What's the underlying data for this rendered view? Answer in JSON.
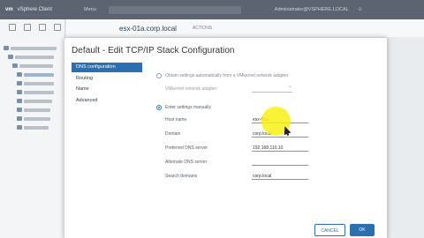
{
  "topbar": {
    "app_name": "vSphere Client",
    "menu_label": "Menu",
    "user_label": "Administrator@VSPHERE.LOCAL",
    "help_label": "?"
  },
  "main": {
    "host_title": "esx-01a.corp.local",
    "actions_label": "ACTIONS"
  },
  "dialog": {
    "title": "Default - Edit TCP/IP Stack Configuration",
    "sidebar": [
      {
        "label": "DNS configuration",
        "active": true
      },
      {
        "label": "Routing",
        "active": false
      },
      {
        "label": "Name",
        "active": false
      },
      {
        "label": "Advanced",
        "active": false
      }
    ],
    "options": {
      "auto_label": "Obtain settings automatically from a VMkernel network adapter",
      "adapter_label": "VMkernel network adapter",
      "manual_label": "Enter settings manually"
    },
    "fields": {
      "host_name_label": "Host name",
      "host_name_value": "esx-01a",
      "domain_label": "Domain",
      "domain_value": "corp.local",
      "pref_dns_label": "Preferred DNS server",
      "pref_dns_value": "192.168.110.10",
      "alt_dns_label": "Alternate DNS server",
      "alt_dns_value": "",
      "search_domains_label": "Search domains",
      "search_domains_value": "corp.local"
    },
    "buttons": {
      "cancel": "CANCEL",
      "ok": "OK"
    }
  },
  "colors": {
    "accent": "#2a6fb0",
    "cursor_highlight": "#f8f014"
  }
}
